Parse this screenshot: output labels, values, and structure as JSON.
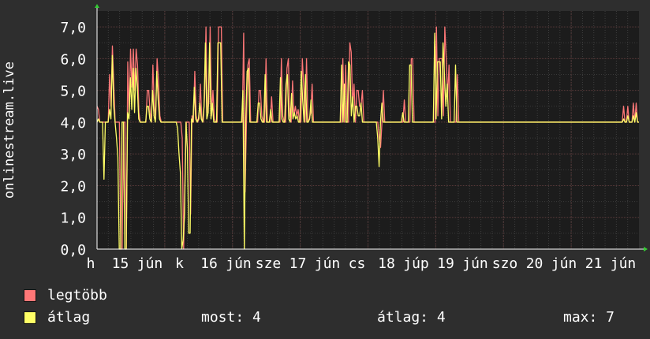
{
  "chart_data": {
    "type": "line",
    "ylabel": "onlinestream.live",
    "ylim": [
      0,
      7.5
    ],
    "yticks": [
      "0,0",
      "1,0",
      "2,0",
      "3,0",
      "4,0",
      "5,0",
      "6,0",
      "7,0"
    ],
    "xticks": [
      "h",
      "15",
      "jún",
      "k",
      "16",
      "jún",
      "sze",
      "17",
      "jún",
      "cs",
      "18",
      "júp",
      "19",
      "jún",
      "szo",
      "20",
      "jún",
      "21",
      "jún"
    ],
    "grid": true,
    "series": [
      {
        "name": "legtöbb",
        "color": "#ff7777",
        "values": [
          4.5,
          4.4,
          4,
          4,
          4,
          4,
          4,
          4,
          4,
          5.5,
          4.5,
          6.4,
          5.2,
          4,
          4,
          4,
          4,
          0,
          0,
          4,
          4,
          0,
          5.9,
          4.2,
          6.3,
          5.1,
          6.3,
          5,
          6.3,
          5.8,
          4.3,
          4,
          4,
          4,
          4,
          4,
          5,
          5,
          4.3,
          4,
          5.8,
          4.5,
          4.1,
          6,
          5.3,
          4.2,
          4,
          4,
          4,
          4,
          4,
          4,
          4,
          4,
          4,
          4,
          4,
          4,
          4,
          4,
          4,
          3.5,
          0,
          2.3,
          4,
          4,
          4,
          1.1,
          4.2,
          4,
          5.6,
          4.2,
          4,
          4.1,
          5.2,
          4.1,
          4,
          4.8,
          7,
          4.3,
          4.6,
          7,
          4.2,
          5,
          4.1,
          4,
          4,
          7,
          7,
          7,
          4,
          4,
          4,
          4,
          4,
          4,
          4,
          4,
          4,
          4,
          4,
          4,
          4,
          4,
          4,
          6.8,
          1.8,
          4,
          5.8,
          6,
          4,
          4,
          4,
          4,
          4,
          4,
          5,
          5,
          4.2,
          4,
          4,
          6,
          4,
          4,
          4,
          4.8,
          4,
          4,
          4,
          4,
          4,
          4,
          6,
          4.2,
          4,
          4,
          5.7,
          6,
          4.2,
          4,
          5.3,
          4.2,
          4.5,
          4.2,
          4.4,
          4,
          4,
          6,
          5.1,
          4,
          6,
          4,
          4.1,
          4.3,
          5.2,
          4,
          4,
          4,
          4,
          4,
          4,
          4,
          4,
          4,
          4,
          4,
          4,
          4,
          4,
          4,
          4,
          4,
          4,
          4,
          4,
          4,
          6,
          4,
          5.8,
          4,
          4,
          6.5,
          6.2,
          4.5,
          5.2,
          4,
          5,
          5,
          4.5,
          4.5,
          5,
          4,
          4,
          4,
          4,
          4,
          4,
          4,
          4,
          4,
          4,
          4,
          3.5,
          3.2,
          4,
          5,
          4,
          4,
          4,
          4,
          4,
          4,
          4,
          4,
          4,
          4,
          4,
          4,
          4,
          4,
          4.7,
          4,
          4,
          4,
          4,
          6,
          6,
          4,
          4,
          4,
          4,
          4,
          4,
          4,
          4,
          4,
          4,
          4,
          4,
          4,
          4,
          4,
          4,
          7,
          4.2,
          6,
          6,
          6,
          4.2,
          7,
          6,
          4.8,
          5.8,
          4,
          4,
          4,
          4,
          4,
          5.5,
          4,
          4,
          4,
          4,
          4,
          4,
          4,
          4,
          4,
          4,
          4,
          4,
          4,
          4,
          4,
          4,
          4,
          4,
          4,
          4,
          4,
          4,
          4,
          4,
          4,
          4,
          4,
          4,
          4,
          4,
          4,
          4,
          4,
          4,
          4,
          4,
          4,
          4,
          4,
          4,
          4,
          4,
          4,
          4,
          4,
          4,
          4,
          4,
          4,
          4,
          4,
          4,
          4,
          4,
          4,
          4,
          4,
          4,
          4,
          4,
          4,
          4,
          4,
          4,
          4,
          4,
          4,
          4,
          4,
          4,
          4,
          4,
          4,
          4,
          4,
          4,
          4,
          4,
          4,
          4,
          4,
          4,
          4,
          4,
          4,
          4,
          4,
          4,
          4,
          4,
          4,
          4,
          4,
          4,
          4,
          4,
          4,
          4,
          4,
          4,
          4,
          4,
          4,
          4,
          4,
          4,
          4,
          4,
          4,
          4,
          4,
          4,
          4,
          4,
          4,
          4,
          4,
          4,
          4.5,
          4,
          4,
          4.5,
          4,
          4,
          4,
          4.6,
          4,
          4.6,
          4,
          4
        ]
      },
      {
        "name": "átlag",
        "color": "#ffff66",
        "values": [
          4,
          4.1,
          4,
          4,
          4,
          2.2,
          4,
          4,
          4,
          4.4,
          4.1,
          6.1,
          4.5,
          4,
          3.5,
          2.9,
          0,
          0,
          4,
          4,
          0,
          0,
          4.3,
          4.1,
          5.4,
          4.4,
          5.7,
          4.3,
          5.7,
          5.1,
          4.1,
          4,
          4,
          4,
          4,
          4,
          4.5,
          4.5,
          4.1,
          4,
          5,
          4.2,
          4,
          5.6,
          4.7,
          4.1,
          4,
          4,
          4,
          4,
          4,
          4,
          4,
          4,
          4,
          4,
          4,
          4,
          3.8,
          3,
          2.4,
          0,
          0.3,
          1.1,
          4,
          3.2,
          0.5,
          0.5,
          4.1,
          4,
          5.1,
          4.1,
          4,
          4.1,
          4.6,
          4.1,
          4,
          4.5,
          6.5,
          4.1,
          4.3,
          6.5,
          4.1,
          4.6,
          4,
          4,
          4,
          6.5,
          6.5,
          6.5,
          4,
          4,
          4,
          4,
          4,
          4,
          4,
          4,
          4,
          4,
          4,
          4,
          4,
          4,
          4,
          5,
          0,
          4,
          5.6,
          5.7,
          4,
          4,
          4,
          4,
          4,
          4,
          4.6,
          4.6,
          4.1,
          4,
          4,
          5.5,
          4,
          4,
          4,
          4.4,
          4,
          4,
          4,
          4,
          4,
          4,
          5.4,
          4.1,
          4,
          4,
          5.2,
          5.5,
          4.1,
          4,
          4.9,
          4.1,
          4.3,
          4.1,
          4.2,
          4,
          4,
          5.6,
          4.7,
          4,
          5.5,
          4,
          4,
          4.1,
          4.7,
          4,
          4,
          4,
          4,
          4,
          4,
          4,
          4,
          4,
          4,
          4,
          4,
          4,
          4,
          4,
          4,
          4,
          4,
          4,
          4,
          4,
          5.8,
          4,
          5.2,
          4,
          4,
          5.9,
          5.8,
          4.2,
          4.8,
          4,
          4.5,
          4.5,
          4.2,
          4.2,
          4.6,
          4,
          4,
          4,
          4,
          4,
          4,
          4,
          4,
          4,
          4,
          4,
          3.5,
          2.6,
          4,
          4.6,
          4,
          4,
          4,
          4,
          4,
          4,
          4,
          4,
          4,
          4,
          4,
          4,
          4,
          4,
          4.3,
          4,
          4,
          4,
          4,
          5.8,
          5.8,
          4,
          4,
          4,
          4,
          4,
          4,
          4,
          4,
          4,
          4,
          4,
          4,
          4,
          4,
          4,
          4,
          6.8,
          4.1,
          5.9,
          5.9,
          5.9,
          4.1,
          6.5,
          5.5,
          4.5,
          5.2,
          4,
          4,
          4,
          4,
          4,
          5.8,
          4,
          4,
          4,
          4,
          4,
          4,
          4,
          4,
          4,
          4,
          4,
          4,
          4,
          4,
          4,
          4,
          4,
          4,
          4,
          4,
          4,
          4,
          4,
          4,
          4,
          4,
          4,
          4,
          4,
          4,
          4,
          4,
          4,
          4,
          4,
          4,
          4,
          4,
          4,
          4,
          4,
          4,
          4,
          4,
          4,
          4,
          4,
          4,
          4,
          4,
          4,
          4,
          4,
          4,
          4,
          4,
          4,
          4,
          4,
          4,
          4,
          4,
          4,
          4,
          4,
          4,
          4,
          4,
          4,
          4,
          4,
          4,
          4,
          4,
          4,
          4,
          4,
          4,
          4,
          4,
          4,
          4,
          4,
          4,
          4,
          4,
          4,
          4,
          4,
          4,
          4,
          4,
          4,
          4,
          4,
          4,
          4,
          4,
          4,
          4,
          4,
          4,
          4,
          4,
          4,
          4,
          4,
          4,
          4,
          4,
          4,
          4,
          4,
          4,
          4,
          4,
          4,
          4,
          4,
          4,
          4.1,
          4,
          4,
          4.2,
          4,
          4,
          4,
          4.2,
          4,
          4.3,
          4,
          4
        ]
      }
    ]
  },
  "legend": {
    "series1_label": "legtöbb",
    "series2_label": "átlag",
    "series1_color": "#ff7777",
    "series2_color": "#ffff66"
  },
  "stats": {
    "now": "most: 4",
    "avg": "átlag: 4",
    "max": "max: 7"
  }
}
